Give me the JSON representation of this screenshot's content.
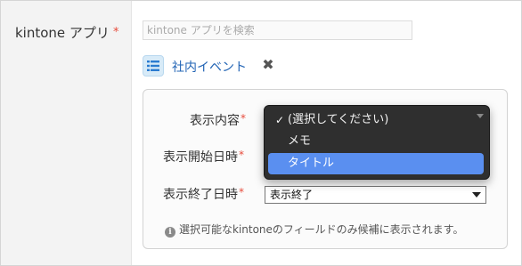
{
  "app_field": {
    "label": "kintone アプリ",
    "required_mark": "*",
    "search_placeholder": "kintone アプリを検索",
    "selected_app": "社内イベント",
    "remove_symbol": "✖",
    "icon": "list-app-icon"
  },
  "settings": {
    "display_content": {
      "label": "表示内容",
      "required_mark": "*"
    },
    "display_start": {
      "label": "表示開始日時",
      "required_mark": "*"
    },
    "display_end": {
      "label": "表示終了日時",
      "required_mark": "*",
      "value": "表示終了"
    },
    "info_text": "選択可能なkintoneのフィールドのみ候補に表示されます。"
  },
  "dropdown": {
    "options": [
      {
        "label": "(選択してください)",
        "checked": true
      },
      {
        "label": "メモ",
        "checked": false
      },
      {
        "label": "タイトル",
        "highlighted": true
      }
    ],
    "check_mark": "✓",
    "highlight_color": "#5a8ff0"
  },
  "colors": {
    "required": "#e74c3c",
    "link": "#2264b5"
  }
}
